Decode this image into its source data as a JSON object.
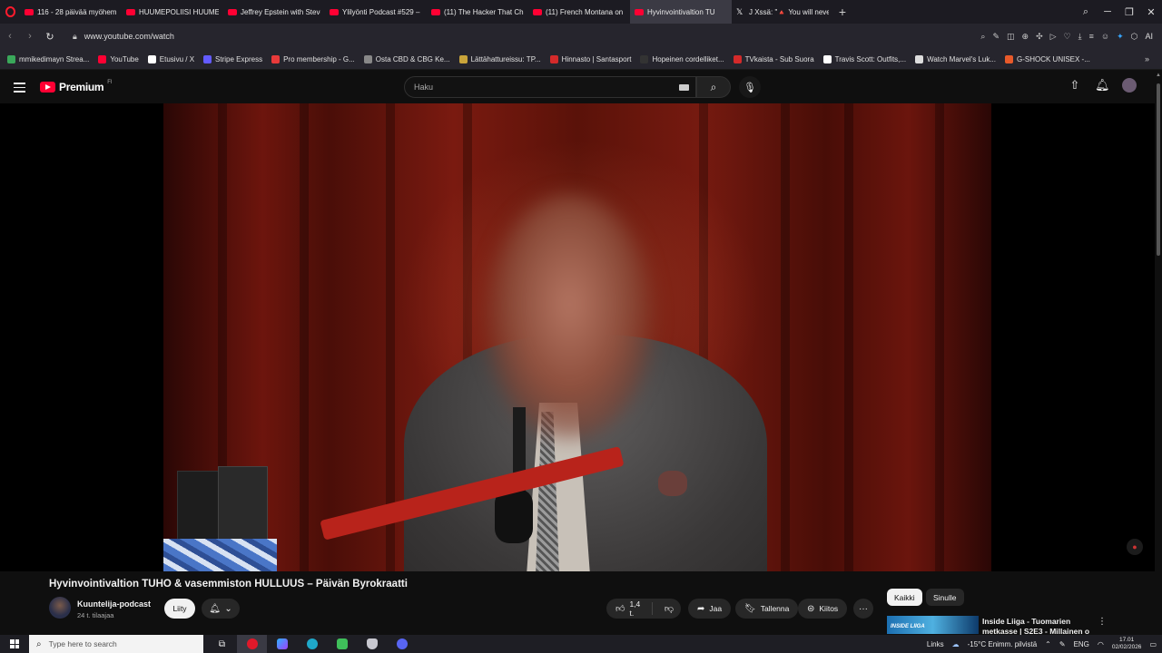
{
  "browser": {
    "tabs": [
      {
        "label": "116 - 28 päivää myöhemm",
        "icon": "youtube-icon",
        "active": false
      },
      {
        "label": "HUUMEPOLIISI HUUMEK",
        "icon": "youtube-icon",
        "active": false
      },
      {
        "label": "Jeffrey Epstein with Steve",
        "icon": "youtube-icon",
        "active": false
      },
      {
        "label": "Ylilyönti Podcast #529 – Li",
        "icon": "youtube-icon",
        "active": false
      },
      {
        "label": "(11) The Hacker That Char",
        "icon": "youtube-icon",
        "active": false
      },
      {
        "label": "(11) French Montana on E",
        "icon": "youtube-icon",
        "active": false
      },
      {
        "label": "Hyvinvointivaltion TU",
        "icon": "youtube-icon",
        "active": true
      },
      {
        "label": "J Xssä: \"🔺 You will never",
        "icon": "x-icon",
        "active": false
      }
    ],
    "url": "www.youtube.com/watch",
    "ai_label": "AI",
    "bookmarks": [
      {
        "label": "mmikedimayn Strea...",
        "color": "#3aa85a"
      },
      {
        "label": "YouTube",
        "color": "#ff0033"
      },
      {
        "label": "Etusivu / X",
        "color": "#ffffff"
      },
      {
        "label": "Stripe Express",
        "color": "#635bff"
      },
      {
        "label": "Pro membership - G...",
        "color": "#e83a3a"
      },
      {
        "label": "Osta CBD & CBG Ke...",
        "color": "#888888"
      },
      {
        "label": "Lättähattureissu: TP...",
        "color": "#c9a43a"
      },
      {
        "label": "Hinnasto | Santasport",
        "color": "#d42a2a"
      },
      {
        "label": "Hopeinen cordelliket...",
        "color": "#333333"
      },
      {
        "label": "TVkaista - Sub Suora",
        "color": "#d42a2a"
      },
      {
        "label": "Travis Scott: Outfits,...",
        "color": "#ffffff"
      },
      {
        "label": "Watch Marvel's Luk...",
        "color": "#dddddd"
      },
      {
        "label": "G-SHOCK UNISEX -...",
        "color": "#e85a2a"
      }
    ]
  },
  "youtube": {
    "logo_text": "Premium",
    "country_code": "FI",
    "search_placeholder": "Haku"
  },
  "video": {
    "title": "Hyvinvointivaltion TUHO & vasemmiston HULLUUS – Päivän Byrokraatti",
    "channel": "Kuuntelija-podcast",
    "subscribers": "24 t. tilaajaa",
    "join_label": "Liity",
    "likes": "1,4 t.",
    "share_label": "Jaa",
    "save_label": "Tallenna",
    "thanks_label": "Kiitos"
  },
  "sidebar": {
    "chips": [
      "Kaikki",
      "Sinulle"
    ],
    "recommendation": {
      "title": "Inside Liiga - Tuomarien metkasse | S2E3 - Millainen o",
      "thumb_text": "INSIDE LIIGA"
    }
  },
  "taskbar": {
    "search_placeholder": "Type here to search",
    "links_label": "Links",
    "weather": "-15°C  Enimm. pilvistä",
    "lang": "ENG",
    "time": "17.01",
    "date": "02/02/2026"
  }
}
